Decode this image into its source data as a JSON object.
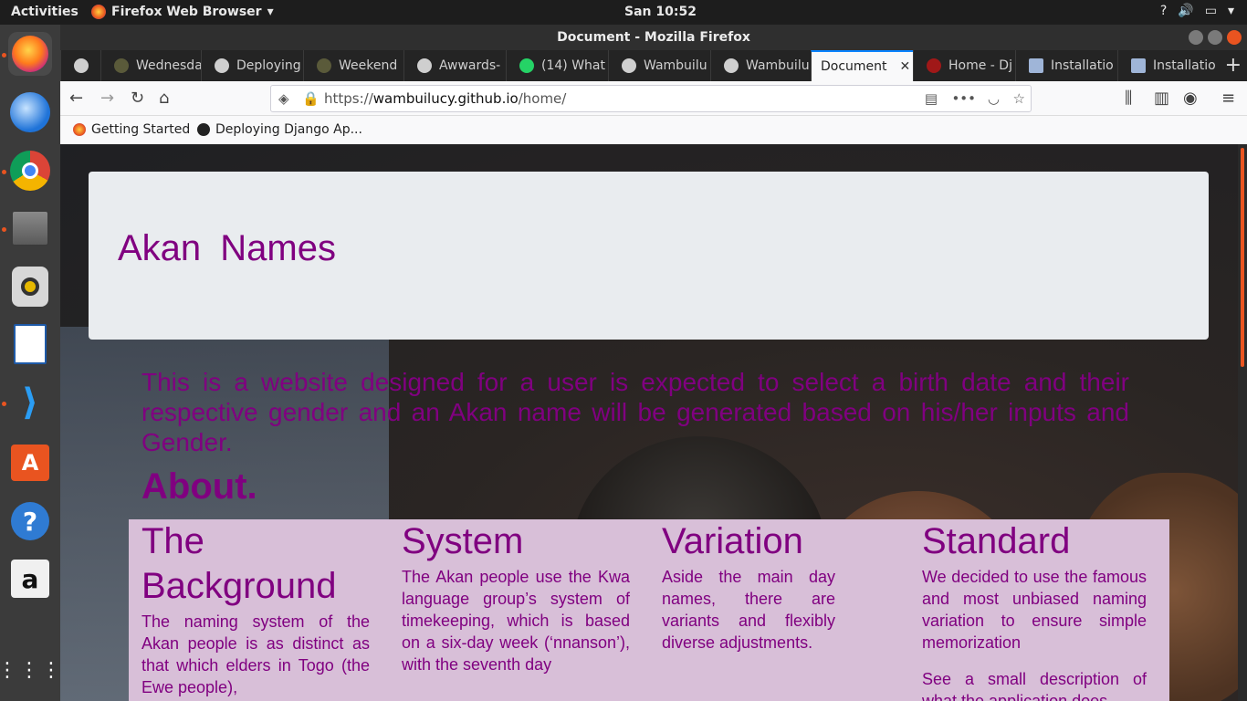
{
  "topbar": {
    "activities": "Activities",
    "app_menu": "Firefox Web Browser",
    "clock": "San 10:52"
  },
  "dock": {
    "items": [
      "firefox",
      "thunderbird",
      "chrome",
      "files",
      "rhythmbox",
      "libreoffice-writer",
      "vscode",
      "software-center",
      "help",
      "amazon",
      "show-apps"
    ]
  },
  "window": {
    "title": "Document - Mozilla Firefox"
  },
  "tabs": [
    {
      "label": "",
      "icon": "github-icon"
    },
    {
      "label": "Wednesda",
      "icon": "github-icon"
    },
    {
      "label": "Deploying",
      "icon": "github-icon"
    },
    {
      "label": "Weekend",
      "icon": "github-icon"
    },
    {
      "label": "Awwards-",
      "icon": "github-icon"
    },
    {
      "label": "(14) What",
      "icon": "whatsapp-icon"
    },
    {
      "label": "Wambuilu",
      "icon": "github-icon"
    },
    {
      "label": "Wambuilu",
      "icon": "github-icon"
    },
    {
      "label": "Document",
      "icon": "",
      "active": true
    },
    {
      "label": "Home - Dj",
      "icon": "django-icon"
    },
    {
      "label": "Installatio",
      "icon": "doc-icon"
    },
    {
      "label": "Installatio",
      "icon": "doc-icon"
    }
  ],
  "urlbar": {
    "scheme": "https://",
    "host": "wambuilucy.github.io",
    "path": "/home/"
  },
  "bookmarks": [
    {
      "label": "Getting Started"
    },
    {
      "label": "Deploying Django Ap..."
    }
  ],
  "page": {
    "heading": "Akan  Names",
    "intro": "This is a website designed for a user is expected to select a birth date and their respective gender and an Akan name will be generated based on his/her inputs and Gender.",
    "about_heading": "About.",
    "cards": [
      {
        "title": "The Background",
        "text": "The naming system of the Akan people is as distinct as that which elders in Togo (the Ewe people),"
      },
      {
        "title": "System",
        "text": "The Akan people use the Kwa language group’s system of timekeeping, which is based on a six-day week (‘nnanson’), with the seventh day"
      },
      {
        "title": "Variation",
        "text": "Aside the main day names, there are variants and flexibly diverse adjustments."
      },
      {
        "title": "Standard",
        "text": "We decided to use the famous and most unbiased naming variation to ensure simple memorization",
        "text2": "See a small description of what the application does"
      }
    ]
  },
  "colors": {
    "accent": "#800080",
    "jumbotron_bg": "#e9ecef",
    "cards_bg": "#d8bfd8",
    "ubuntu_orange": "#e95420"
  }
}
